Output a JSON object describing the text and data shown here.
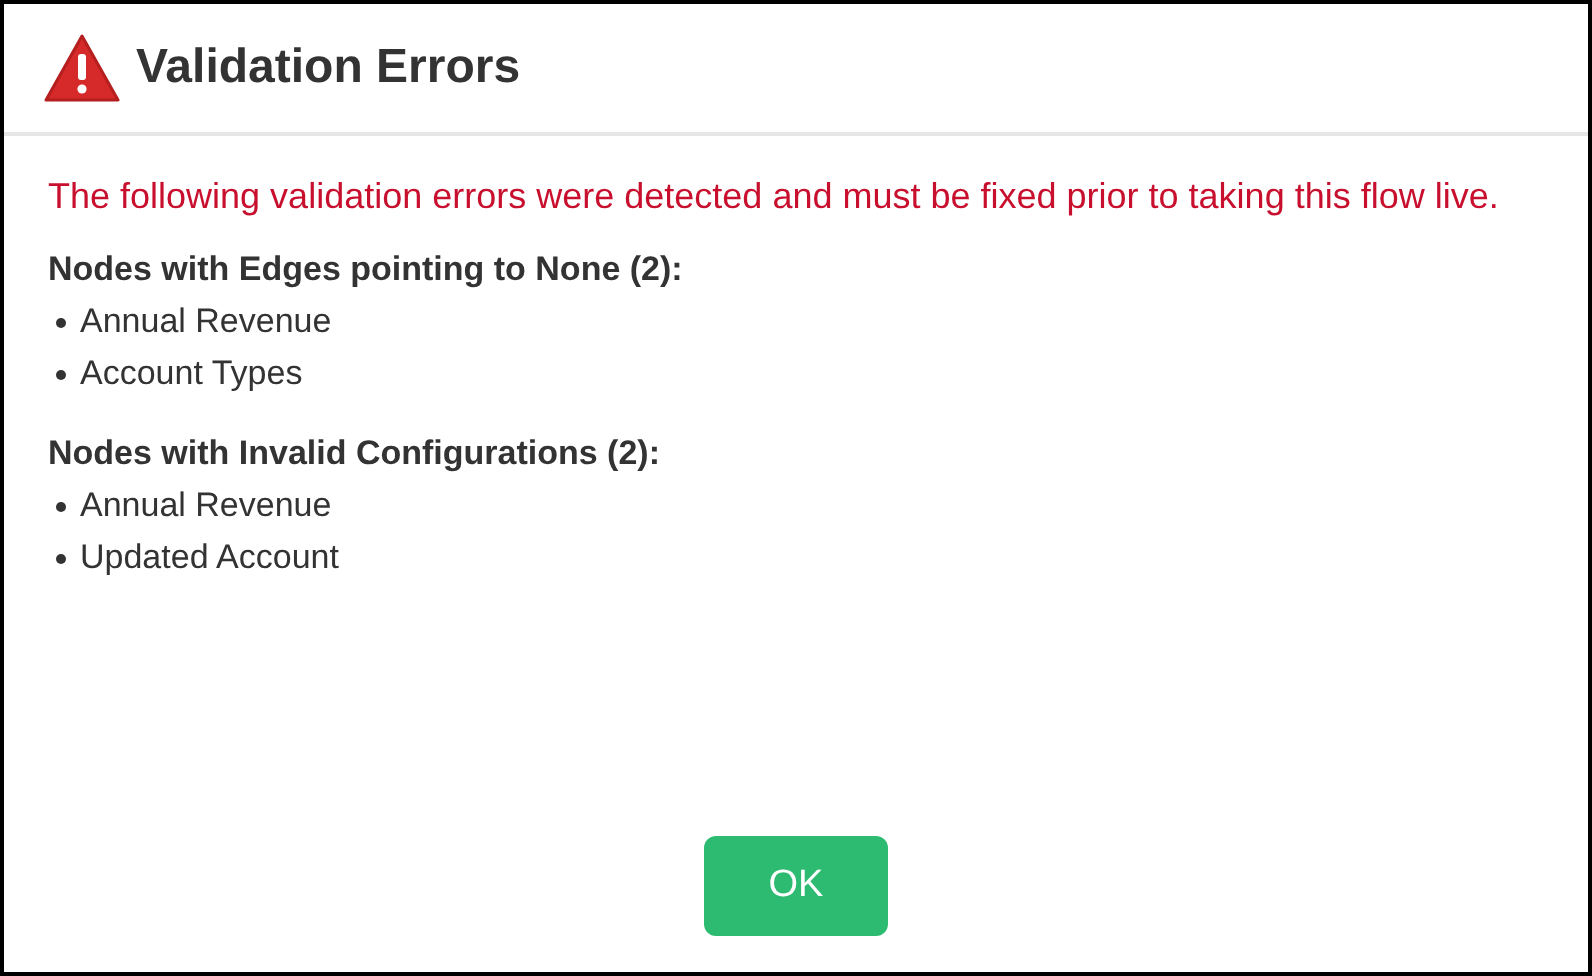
{
  "dialog": {
    "title": "Validation Errors"
  },
  "message": "The following validation errors were detected and must be fixed prior to taking this flow live.",
  "sections": [
    {
      "heading": "Nodes with Edges pointing to None (2):",
      "items": [
        "Annual Revenue",
        "Account Types"
      ]
    },
    {
      "heading": "Nodes with Invalid Configurations (2):",
      "items": [
        "Annual Revenue",
        "Updated Account"
      ]
    }
  ],
  "buttons": [
    "OK"
  ]
}
